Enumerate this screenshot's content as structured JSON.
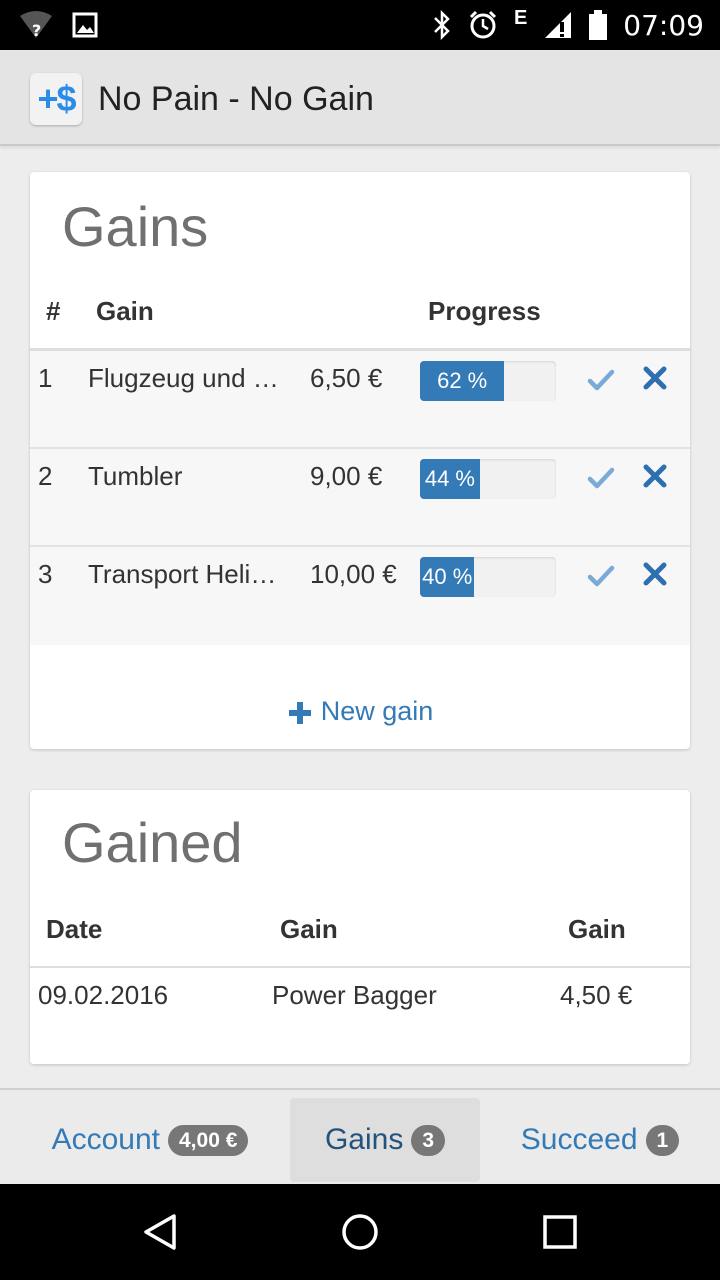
{
  "status_bar": {
    "time": "07:09",
    "network_label": "E",
    "icons": [
      "wifi-question-icon",
      "image-icon",
      "bluetooth-icon",
      "alarm-icon",
      "signal-icon",
      "battery-icon"
    ]
  },
  "app_bar": {
    "icon_text": "+$",
    "title": "No Pain - No Gain"
  },
  "gains_card": {
    "title": "Gains",
    "columns": {
      "num": "#",
      "name": "Gain",
      "progress": "Progress"
    },
    "rows": [
      {
        "num": "1",
        "name": "Flugzeug und Hubschrauber",
        "price": "6,50 €",
        "progress_label": "62 %",
        "progress_value": 62
      },
      {
        "num": "2",
        "name": "Tumbler",
        "price": "9,00 €",
        "progress_label": "44 %",
        "progress_value": 44
      },
      {
        "num": "3",
        "name": "Transport Helikopter",
        "price": "10,00 €",
        "progress_label": "40 %",
        "progress_value": 40
      }
    ],
    "new_gain_label": "New gain"
  },
  "gained_card": {
    "title": "Gained",
    "columns": {
      "date": "Date",
      "gain": "Gain",
      "amount": "Gain"
    },
    "rows": [
      {
        "date": "09.02.2016",
        "gain": "Power Bagger",
        "amount": "4,50 €"
      }
    ]
  },
  "tabs": [
    {
      "label": "Account",
      "badge": "4,00 €",
      "active": false
    },
    {
      "label": "Gains",
      "badge": "3",
      "active": true
    },
    {
      "label": "Succeed",
      "badge": "1",
      "active": false
    }
  ],
  "colors": {
    "accent": "#337ab7",
    "progress_fill": "#337ab7",
    "check": "#7aaad6",
    "cross": "#2e6fb0",
    "badge": "#777777"
  }
}
